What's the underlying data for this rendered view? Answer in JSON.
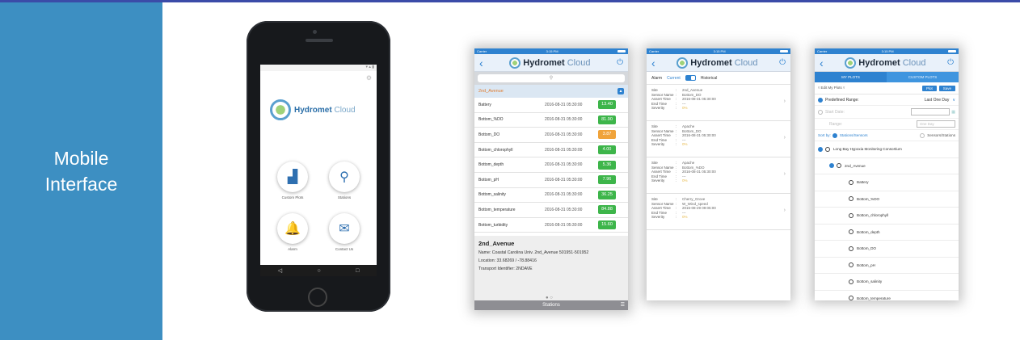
{
  "side_label": [
    "Mobile",
    "Interface"
  ],
  "phone": {
    "brand_a": "Hydrom",
    "brand_b": "et",
    "brand_c": "Cloud",
    "tiles": [
      {
        "label": "Custom Plots",
        "icon": "chart-icon"
      },
      {
        "label": "Stations",
        "icon": "map-pin-icon"
      },
      {
        "label": "Alarm",
        "icon": "bell-icon"
      },
      {
        "label": "Contact Us",
        "icon": "mail-icon"
      }
    ]
  },
  "status": {
    "carrier": "Carrier",
    "time": "3:15 PM"
  },
  "logo": {
    "bold": "Hydromet",
    "light": "Cloud"
  },
  "stations_screen": {
    "search_icon": "search-icon",
    "group": "2nd_Avenue",
    "rows": [
      {
        "name": "Battery",
        "time": "2016-08-31 05:30:00",
        "value": "13.40",
        "color": "#3db54a"
      },
      {
        "name": "Bottom_%DO",
        "time": "2016-08-31 05:30:00",
        "value": "81.90",
        "color": "#3db54a"
      },
      {
        "name": "Bottom_DO",
        "time": "2016-08-31 05:30:00",
        "value": "3.87",
        "color": "#f0a33a"
      },
      {
        "name": "Bottom_chlorophyll",
        "time": "2016-08-31 05:30:00",
        "value": "4.00",
        "color": "#3db54a"
      },
      {
        "name": "Bottom_depth",
        "time": "2016-08-31 05:30:00",
        "value": "5.36",
        "color": "#3db54a"
      },
      {
        "name": "Bottom_pH",
        "time": "2016-08-31 05:30:00",
        "value": "7.96",
        "color": "#3db54a"
      },
      {
        "name": "Bottom_salinity",
        "time": "2016-08-31 05:30:00",
        "value": "36.25",
        "color": "#3db54a"
      },
      {
        "name": "Bottom_temperature",
        "time": "2016-08-31 05:30:00",
        "value": "84.88",
        "color": "#3db54a"
      },
      {
        "name": "Bottom_turbidity",
        "time": "2016-08-31 05:30:00",
        "value": "15.60",
        "color": "#3db54a"
      }
    ],
    "info": {
      "title": "2nd_Avenue",
      "name_label": "Name:",
      "name_value": "Coastal Carolina Univ. 2nd_Avenue 501951-501952",
      "location_label": "Location:",
      "location_value": "33.68269 / -78.88416",
      "transport_label": "Transport Identifier:",
      "transport_value": "2NDAVE"
    },
    "tab": "Stations"
  },
  "alarm_screen": {
    "seg": {
      "alarm": "Alarm",
      "current": "Current",
      "historical": "Historical"
    },
    "labels": {
      "site": "Site",
      "sensor": "Sensor Name",
      "assert": "Assert Time",
      "end": "End Time",
      "severity": "Severity"
    },
    "items": [
      {
        "site": "2nd_Avenue",
        "sensor": "Bottom_DO",
        "assert": "2016-08-31 05:30:00",
        "end": "---",
        "severity": "0%"
      },
      {
        "site": "Apache",
        "sensor": "Bottom_DO",
        "assert": "2016-08-31 05:30:00",
        "end": "---",
        "severity": "0%"
      },
      {
        "site": "Apache",
        "sensor": "Bottom_%DO",
        "assert": "2016-08-31 05:30:00",
        "end": "---",
        "severity": "0%"
      },
      {
        "site": "Cherry_Grove",
        "sensor": "W_Wind_speed",
        "assert": "2015-08-29 09:05:00",
        "end": "---",
        "severity": "0%"
      }
    ]
  },
  "plots_screen": {
    "tab_my": "MY PLOTS",
    "tab_custom": "CUSTOM PLOTS",
    "edit": "Edit My Plots",
    "plot": "Plot",
    "save": "Save",
    "predef": "Predefined Range:",
    "predef_value": "Last One Day",
    "start": "Start Date:",
    "range": "Range:",
    "range_value": "One Day",
    "sortby": "Sort by:",
    "sort1": "Stations/Sensors",
    "sort2": "Sensors/Stations",
    "root": "Long Bay Hypoxia Monitoring Consortium",
    "station": "2nd_Avenue",
    "sensors": [
      "Battery",
      "Bottom_%DO",
      "Bottom_chlorophyll",
      "Bottom_depth",
      "Bottom_DO",
      "Bottom_pH",
      "Bottom_salinity",
      "Bottom_temperature"
    ]
  }
}
